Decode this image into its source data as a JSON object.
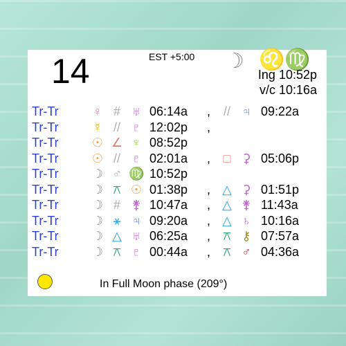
{
  "header": {
    "day": "14",
    "timezone": "EST +5:00",
    "moon_symbol": "☽",
    "sign_symbol": "♌♍",
    "ingress": "Ing 10:52p",
    "void_of_course": "v/c 10:16a"
  },
  "colors": {
    "label": "#2a3fd6",
    "moon": "#8c8c8c",
    "venus": "#e67ac1",
    "mercury": "#d8b400",
    "sun": "#f3a34c",
    "uranus": "#c266cf",
    "jupiter": "#6a8bd6",
    "neptune": "#9ad44d",
    "pluto": "#c266cf",
    "ceres": "#c266cf",
    "saturn": "#a86bdb",
    "chiron": "#9a8c20",
    "mars": "#d23c3c",
    "aspect_gray": "#b0b0b0",
    "trine": "#2aa7e6",
    "sextile": "#2aa7e6",
    "square": "#e47b6a",
    "semisextile": "#20a870",
    "semisquare": "#e47b6a",
    "quintile": "#9a9a9a"
  },
  "rows": [
    {
      "label": "Tr-Tr",
      "p1": "♀",
      "p1c": "#e67ac1",
      "asp1": "#",
      "asp1c": "#b0b0b0",
      "p2": "♅",
      "p2c": "#c266cf",
      "time1": "06:14a",
      "comma": ",",
      "asp2": "//",
      "asp2c": "#b0b0b0",
      "p3": "♃",
      "p3c": "#6a8bd6",
      "time2": "09:22a"
    },
    {
      "label": "Tr-Tr",
      "p1": "☿",
      "p1c": "#d8b400",
      "asp1": "//",
      "asp1c": "#b0b0b0",
      "p2": "♇",
      "p2c": "#c266cf",
      "time1": "12:02p",
      "comma": ",",
      "asp2": "",
      "asp2c": "#b0b0b0",
      "p3": "",
      "p3c": "#000",
      "time2": ""
    },
    {
      "label": "Tr-Tr",
      "p1": "☉",
      "p1c": "#f3a34c",
      "asp1": "∠",
      "asp1c": "#e47b6a",
      "p2": "♆",
      "p2c": "#9ad44d",
      "time1": "08:52p",
      "comma": "",
      "asp2": "",
      "asp2c": "#b0b0b0",
      "p3": "",
      "p3c": "#000",
      "time2": ""
    },
    {
      "label": "Tr-Tr",
      "p1": "☉",
      "p1c": "#f3a34c",
      "asp1": "//",
      "asp1c": "#b0b0b0",
      "p2": "♇",
      "p2c": "#c266cf",
      "time1": "02:01a",
      "comma": ",",
      "asp2": "□",
      "asp2c": "#e47b6a",
      "p3": "⚳",
      "p3c": "#c266cf",
      "time2": "05:06p"
    },
    {
      "label": "Tr-Tr",
      "p1": "☽",
      "p1c": "#8c8c8c",
      "asp1": "♂",
      "asp1c": "#b0b0b0",
      "p2": "♍",
      "p2c": "#7ed321",
      "time1": "10:52p",
      "comma": "",
      "asp2": "",
      "asp2c": "#b0b0b0",
      "p3": "",
      "p3c": "#000",
      "time2": ""
    },
    {
      "label": "Tr-Tr",
      "p1": "☽",
      "p1c": "#8c8c8c",
      "asp1": "⚻",
      "asp1c": "#20a870",
      "p2": "☉",
      "p2c": "#f3a34c",
      "time1": "01:38p",
      "comma": ",",
      "asp2": "△",
      "asp2c": "#2aa7e6",
      "p3": "⚳",
      "p3c": "#c266cf",
      "time2": "01:51p"
    },
    {
      "label": "Tr-Tr",
      "p1": "☽",
      "p1c": "#8c8c8c",
      "asp1": "#",
      "asp1c": "#b0b0b0",
      "p2": "⚵",
      "p2c": "#c266cf",
      "time1": "10:47a",
      "comma": ",",
      "asp2": "△",
      "asp2c": "#2aa7e6",
      "p3": "⚵",
      "p3c": "#c266cf",
      "time2": "11:43a"
    },
    {
      "label": "Tr-Tr",
      "p1": "☽",
      "p1c": "#8c8c8c",
      "asp1": "⚹",
      "asp1c": "#2aa7e6",
      "p2": "♃",
      "p2c": "#6a8bd6",
      "time1": "09:20a",
      "comma": ",",
      "asp2": "△",
      "asp2c": "#2aa7e6",
      "p3": "♄",
      "p3c": "#a86bdb",
      "time2": "10:16a"
    },
    {
      "label": "Tr-Tr",
      "p1": "☽",
      "p1c": "#8c8c8c",
      "asp1": "△",
      "asp1c": "#2aa7e6",
      "p2": "♅",
      "p2c": "#c266cf",
      "time1": "06:25a",
      "comma": ",",
      "asp2": "⚻",
      "asp2c": "#20a870",
      "p3": "⚷",
      "p3c": "#9a8c20",
      "time2": "07:57a"
    },
    {
      "label": "Tr-Tr",
      "p1": "☽",
      "p1c": "#8c8c8c",
      "asp1": "⚻",
      "asp1c": "#20a870",
      "p2": "♇",
      "p2c": "#c266cf",
      "time1": "00:44a",
      "comma": ",",
      "asp2": "⚻",
      "asp2c": "#20a870",
      "p3": "♂",
      "p3c": "#d23c3c",
      "time2": "04:36a"
    }
  ],
  "footer": {
    "phase_text": "In Full Moon phase (209°)",
    "phase_icon": "full-moon-icon",
    "phase_color": "#ffe600"
  }
}
